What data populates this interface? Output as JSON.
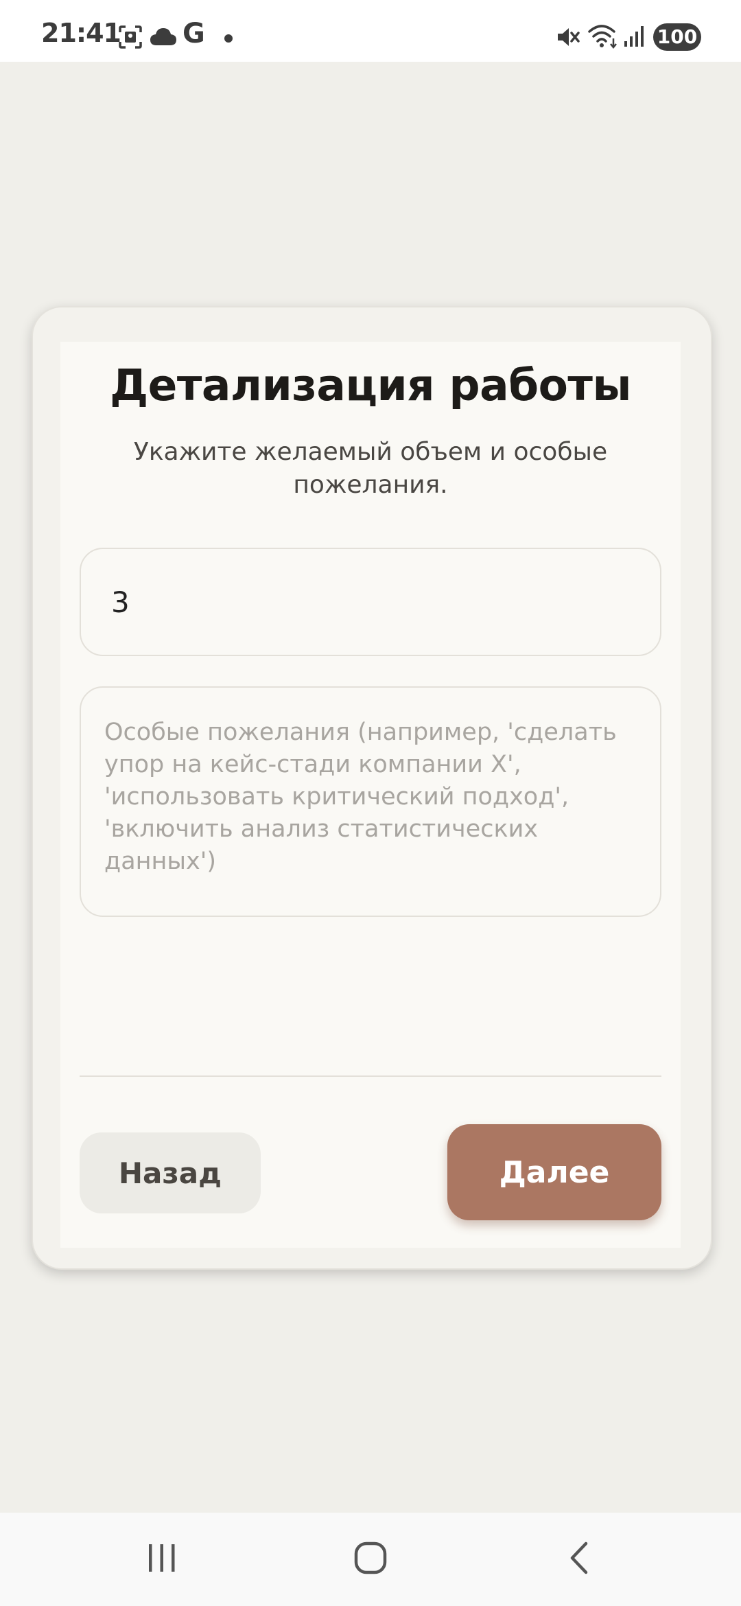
{
  "status_bar": {
    "time": "21:41",
    "left_icons": [
      "screenshot-icon",
      "cloud-icon",
      "google-icon",
      "notification-dot-icon"
    ],
    "google_letter": "G",
    "right_icons": [
      "mute-icon",
      "wifi-icon",
      "signal-icon"
    ],
    "battery": "100"
  },
  "form": {
    "title": "Детализация работы",
    "subtitle": "Укажите желаемый объем и особые пожелания.",
    "quantity_value": "3",
    "wishes_value": "",
    "wishes_placeholder": "Особые пожелания (например, 'сделать упор на кейс-стади компании X', 'использовать критический подход', 'включить анализ статистических данных')",
    "back_label": "Назад",
    "next_label": "Далее"
  },
  "colors": {
    "background": "#f0efea",
    "card": "#faf9f5",
    "accent": "#ab7762",
    "secondary_button": "#ecebe6"
  },
  "nav_bar": {
    "icons": [
      "recent-apps-icon",
      "home-icon",
      "back-icon"
    ]
  }
}
